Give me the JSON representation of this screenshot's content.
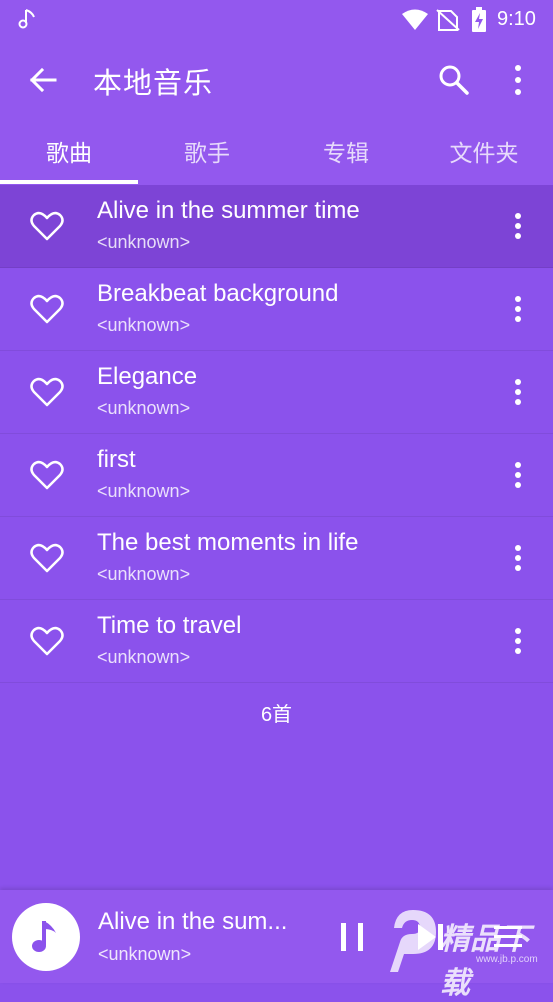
{
  "status_bar": {
    "time": "9:10"
  },
  "app_bar": {
    "title": "本地音乐"
  },
  "tabs": [
    {
      "label": "歌曲",
      "active": true
    },
    {
      "label": "歌手",
      "active": false
    },
    {
      "label": "专辑",
      "active": false
    },
    {
      "label": "文件夹",
      "active": false
    }
  ],
  "songs": [
    {
      "title": "Alive in the summer time",
      "artist": "<unknown>"
    },
    {
      "title": "Breakbeat background",
      "artist": "<unknown>"
    },
    {
      "title": "Elegance",
      "artist": "<unknown>"
    },
    {
      "title": "first",
      "artist": "<unknown>"
    },
    {
      "title": "The best moments in life",
      "artist": "<unknown>"
    },
    {
      "title": "Time to travel",
      "artist": "<unknown>"
    }
  ],
  "song_count": "6首",
  "now_playing": {
    "title": "Alive in the sum...",
    "artist": "<unknown>"
  },
  "watermark": {
    "text": "精品下载",
    "url": "www.jb.p.com"
  },
  "colors": {
    "background": "#8b52ec",
    "bar": "#9358ee",
    "current_row": "#7d44d6"
  }
}
